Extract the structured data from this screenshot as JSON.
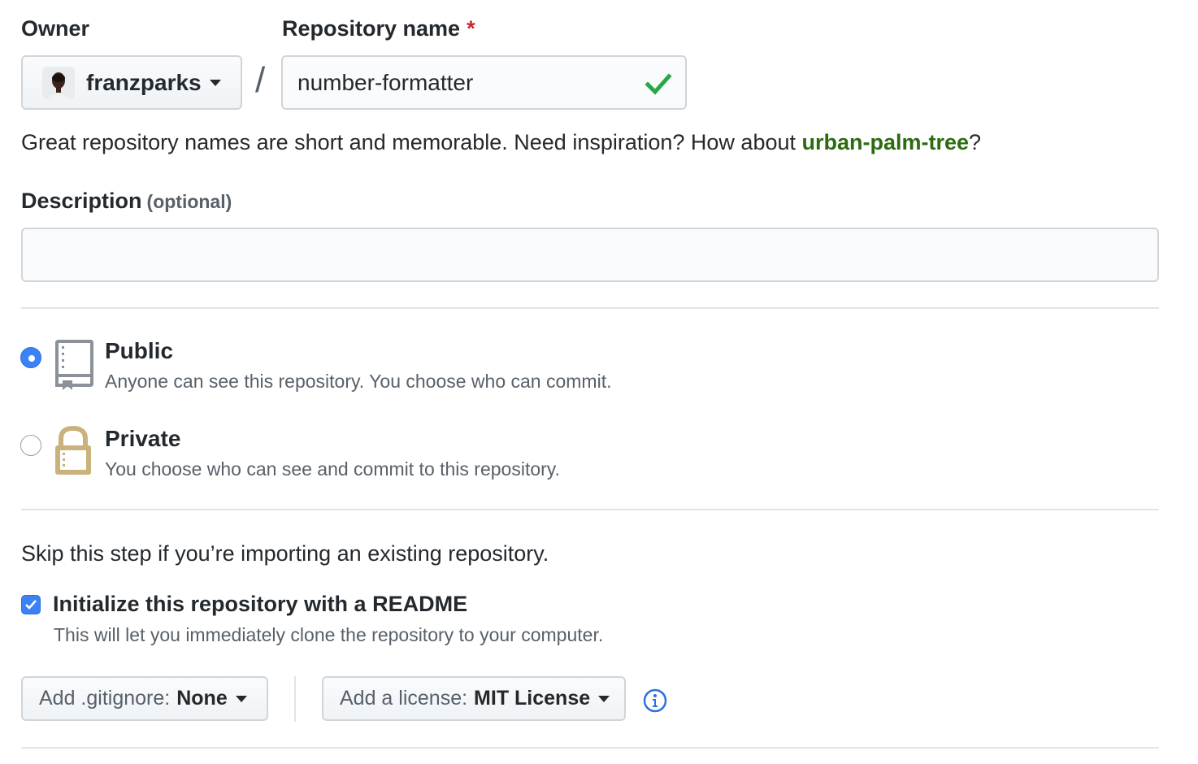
{
  "owner": {
    "label": "Owner",
    "selected": "franzparks",
    "avatar_icon": "user-avatar"
  },
  "repo": {
    "label": "Repository name",
    "required_marker": "*",
    "value": "number-formatter",
    "valid_icon": "check-icon",
    "separator": "/"
  },
  "hint": {
    "prefix": "Great repository names are short and memorable. Need inspiration? How about ",
    "suggestion": "urban-palm-tree",
    "suffix": "?"
  },
  "description": {
    "label": "Description",
    "optional": "(optional)",
    "value": ""
  },
  "visibility": {
    "selected": "public",
    "options": [
      {
        "id": "public",
        "title": "Public",
        "desc": "Anyone can see this repository. You choose who can commit.",
        "icon": "repo-book-icon"
      },
      {
        "id": "private",
        "title": "Private",
        "desc": "You choose who can see and commit to this repository.",
        "icon": "lock-icon"
      }
    ]
  },
  "init": {
    "skip_text": "Skip this step if you’re importing an existing repository.",
    "readme_label": "Initialize this repository with a README",
    "readme_desc": "This will let you immediately clone the repository to your computer.",
    "readme_checked": true
  },
  "gitignore": {
    "label": "Add .gitignore:",
    "value": "None"
  },
  "license": {
    "label": "Add a license:",
    "value": "MIT License",
    "info_icon": "info-icon"
  },
  "colors": {
    "accent_blue": "#3b82f6",
    "success_green": "#28a745",
    "suggestion_green": "#2c6b10",
    "required_red": "#cb2431",
    "lock_gold": "#c9b27c"
  }
}
